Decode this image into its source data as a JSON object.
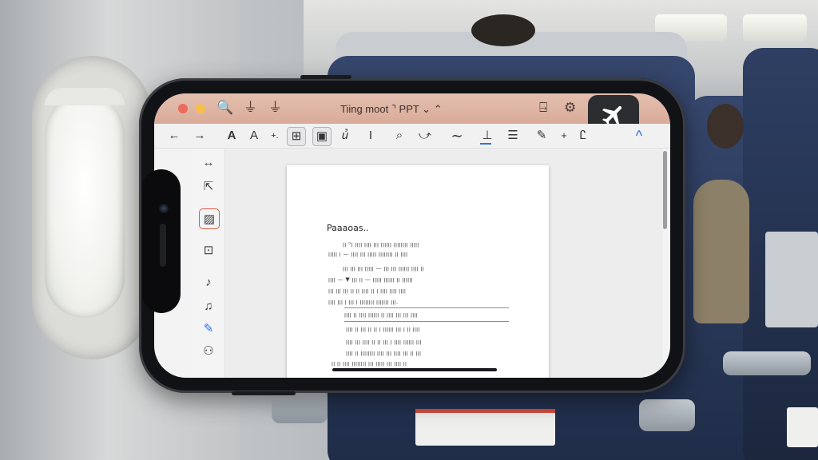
{
  "window": {
    "title": "Tiing moot ⌝ PPT ⌄ ⌃",
    "traffic_lights": [
      "#ec6a5e",
      "#f5bf4f"
    ]
  },
  "titlebar_icons": {
    "search": "🔍",
    "filter1": "⏚",
    "filter2": "⏚",
    "share": "⍈",
    "gear": "⚙",
    "airplane_mode": "airplane-icon"
  },
  "toolbar": {
    "back": "←",
    "forward": "→",
    "font_a1": "A",
    "font_a2": "A",
    "plus_small": "+.",
    "select_grid": "⊞",
    "image": "▣",
    "shapes": "ꞿ",
    "text_cursor": "I",
    "lasso": "⌕",
    "pen": "⤻",
    "wave": "∼",
    "align_bottom": "⊥",
    "menu": "☰",
    "edit_box": "✎",
    "add": "+",
    "text_style": "Ꮭ",
    "chevron": "^"
  },
  "palette": {
    "resize": "↔",
    "pointer": "⇱",
    "frame": "▨",
    "page": "⊡",
    "music": "♪",
    "shape": "♫",
    "pencil": "✎",
    "group": "⚇"
  },
  "document": {
    "heading": "Paaaoas..",
    "lines": [
      "ꞁꞁ ᴳꞁ ꞁꞁꞁꞁ ꞁꞁꞁꞁ ꞁꞁꞁ ꞁꞁꞁꞁꞁꞁ ꞁꞁꞁꞁꞁꞁꞁꞁ ꞁꞁꞁꞁꞁ",
      "ꞁꞁꞁꞁꞁ ꞁ — ꞁꞁꞁꞁ ꞁꞁꞁ ꞁꞁꞁꞁꞁ ꞁꞁꞁꞁꞁꞁꞁꞁ ꞁꞁ ꞁꞁꞁꞁ",
      "ꞁꞁꞁ ꞁꞁꞁ ꞁꞁꞁ ꞁꞁꞁꞁꞁ — ꞁꞁꞁ ꞁꞁꞁ ꞁꞁꞁꞁꞁꞁ ꞁꞁꞁꞁ ꞁꞁ",
      "ꞁꞁꞁꞁ — ▼ ꞁꞁꞁ ꞁꞁ — ꞁꞁꞁꞁꞁ ꞁꞁꞁꞁꞁꞁ ꞁꞁ ꞁꞁꞁꞁꞁꞁ",
      "ꞁꞁꞁ ꞁꞁꞁ ꞁꞁꞁ ꞁꞁ ꞁꞁ ꞁꞁꞁꞁ ꞁꞁ ꞁ ꞁꞁꞁꞁ ꞁꞁꞁꞁ ꞁꞁꞁꞁ",
      "ꞁꞁꞁꞁ ꞁꞁꞁ ꞁ ꞁꞁꞁ ꞁ ꞁꞁꞁꞁꞁꞁꞁꞁ ꞁꞁꞁꞁꞁꞁꞁ ꞁꞁꞁ.",
      "ꞁꞁꞁꞁ ꞁꞁ ꞁꞁꞁꞁ ꞁꞁꞁꞁꞁꞁ ꞁꞁ ꞁꞁꞁꞁ ꞁꞁꞁ ꞁꞁꞁ ꞁꞁꞁꞁ",
      "ꞁꞁꞁꞁ ꞁꞁ ꞁꞁꞁ ꞁꞁ ꞁꞁ ꞁ ꞁꞁꞁꞁꞁꞁ ꞁꞁꞁ ꞁ ꞁꞁ ꞁꞁꞁꞁ",
      "ꞁꞁꞁꞁ ꞁꞁꞁ ꞁꞁꞁꞁ ꞁꞁ ꞁꞁ ꞁꞁꞁ ꞁ ꞁꞁꞁꞁ ꞁꞁꞁꞁꞁꞁ ꞁꞁꞁ",
      "ꞁꞁꞁꞁ ꞁꞁ ꞁꞁꞁꞁꞁꞁꞁꞁ ꞁꞁꞁꞁ ꞁꞁꞁ ꞁꞁꞁꞁ ꞁꞁꞁ ꞁꞁ ꞁꞁꞁ",
      "ꞁꞁ ꞁꞁ ꞁꞁꞁꞁ ꞁꞁꞁꞁꞁꞁꞁꞁ ꞁꞁꞁ ꞁꞁꞁꞁꞁ ꞁꞁꞁ ꞁꞁꞁꞁ ꞁꞁ"
    ]
  }
}
